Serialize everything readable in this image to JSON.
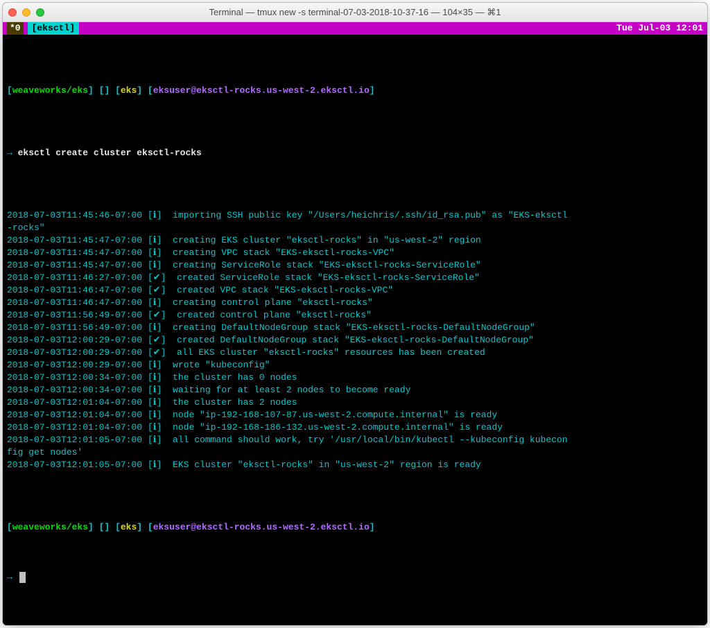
{
  "window": {
    "title": "Terminal — tmux new -s terminal-07-03-2018-10-37-16 — 104×35 — ⌘1"
  },
  "statusbar": {
    "index": "*0",
    "context": "[eksctl]",
    "clock": "Tue Jul-03 12:01"
  },
  "prompt1": {
    "lb1": "[",
    "repo": "weaveworks/eks",
    "rb1": "]",
    "branch_brackets": " [] ",
    "lb2": "[",
    "ctx": "eks",
    "rb2": "]",
    "lb3": " [",
    "user": "eksuser@eksctl-rocks.us-west-2.eksctl.io",
    "rb3": "]"
  },
  "cmd": {
    "arrow": "→ ",
    "text": "eksctl create cluster eksctl-rocks"
  },
  "logs": [
    {
      "ts": "2018-07-03T11:45:46-07:00",
      "lvl": "ℹ",
      "msg": "importing SSH public key \"/Users/heichris/.ssh/id_rsa.pub\" as \"EKS-eksctl"
    },
    {
      "cont": true,
      "msg": "-rocks\""
    },
    {
      "ts": "2018-07-03T11:45:47-07:00",
      "lvl": "ℹ",
      "msg": "creating EKS cluster \"eksctl-rocks\" in \"us-west-2\" region"
    },
    {
      "ts": "2018-07-03T11:45:47-07:00",
      "lvl": "ℹ",
      "msg": "creating VPC stack \"EKS-eksctl-rocks-VPC\""
    },
    {
      "ts": "2018-07-03T11:45:47-07:00",
      "lvl": "ℹ",
      "msg": "creating ServiceRole stack \"EKS-eksctl-rocks-ServiceRole\""
    },
    {
      "ts": "2018-07-03T11:46:27-07:00",
      "lvl": "✔",
      "msg": "created ServiceRole stack \"EKS-eksctl-rocks-ServiceRole\""
    },
    {
      "ts": "2018-07-03T11:46:47-07:00",
      "lvl": "✔",
      "msg": "created VPC stack \"EKS-eksctl-rocks-VPC\""
    },
    {
      "ts": "2018-07-03T11:46:47-07:00",
      "lvl": "ℹ",
      "msg": "creating control plane \"eksctl-rocks\""
    },
    {
      "ts": "2018-07-03T11:56:49-07:00",
      "lvl": "✔",
      "msg": "created control plane \"eksctl-rocks\""
    },
    {
      "ts": "2018-07-03T11:56:49-07:00",
      "lvl": "ℹ",
      "msg": "creating DefaultNodeGroup stack \"EKS-eksctl-rocks-DefaultNodeGroup\""
    },
    {
      "ts": "2018-07-03T12:00:29-07:00",
      "lvl": "✔",
      "msg": "created DefaultNodeGroup stack \"EKS-eksctl-rocks-DefaultNodeGroup\""
    },
    {
      "ts": "2018-07-03T12:00:29-07:00",
      "lvl": "✔",
      "msg": "all EKS cluster \"eksctl-rocks\" resources has been created"
    },
    {
      "ts": "2018-07-03T12:00:29-07:00",
      "lvl": "ℹ",
      "msg": "wrote \"kubeconfig\""
    },
    {
      "ts": "2018-07-03T12:00:34-07:00",
      "lvl": "ℹ",
      "msg": "the cluster has 0 nodes"
    },
    {
      "ts": "2018-07-03T12:00:34-07:00",
      "lvl": "ℹ",
      "msg": "waiting for at least 2 nodes to become ready"
    },
    {
      "ts": "2018-07-03T12:01:04-07:00",
      "lvl": "ℹ",
      "msg": "the cluster has 2 nodes"
    },
    {
      "ts": "2018-07-03T12:01:04-07:00",
      "lvl": "ℹ",
      "msg": "node \"ip-192-168-107-87.us-west-2.compute.internal\" is ready"
    },
    {
      "ts": "2018-07-03T12:01:04-07:00",
      "lvl": "ℹ",
      "msg": "node \"ip-192-168-186-132.us-west-2.compute.internal\" is ready"
    },
    {
      "ts": "2018-07-03T12:01:05-07:00",
      "lvl": "ℹ",
      "msg": "all command should work, try '/usr/local/bin/kubectl --kubeconfig kubecon"
    },
    {
      "cont": true,
      "msg": "fig get nodes'"
    },
    {
      "ts": "2018-07-03T12:01:05-07:00",
      "lvl": "ℹ",
      "msg": "EKS cluster \"eksctl-rocks\" in \"us-west-2\" region is ready"
    }
  ],
  "prompt2": {
    "lb1": "[",
    "repo": "weaveworks/eks",
    "rb1": "]",
    "branch_brackets": " [] ",
    "lb2": "[",
    "ctx": "eks",
    "rb2": "]",
    "lb3": " [",
    "user": "eksuser@eksctl-rocks.us-west-2.eksctl.io",
    "rb3": "]",
    "arrow": "→ "
  }
}
